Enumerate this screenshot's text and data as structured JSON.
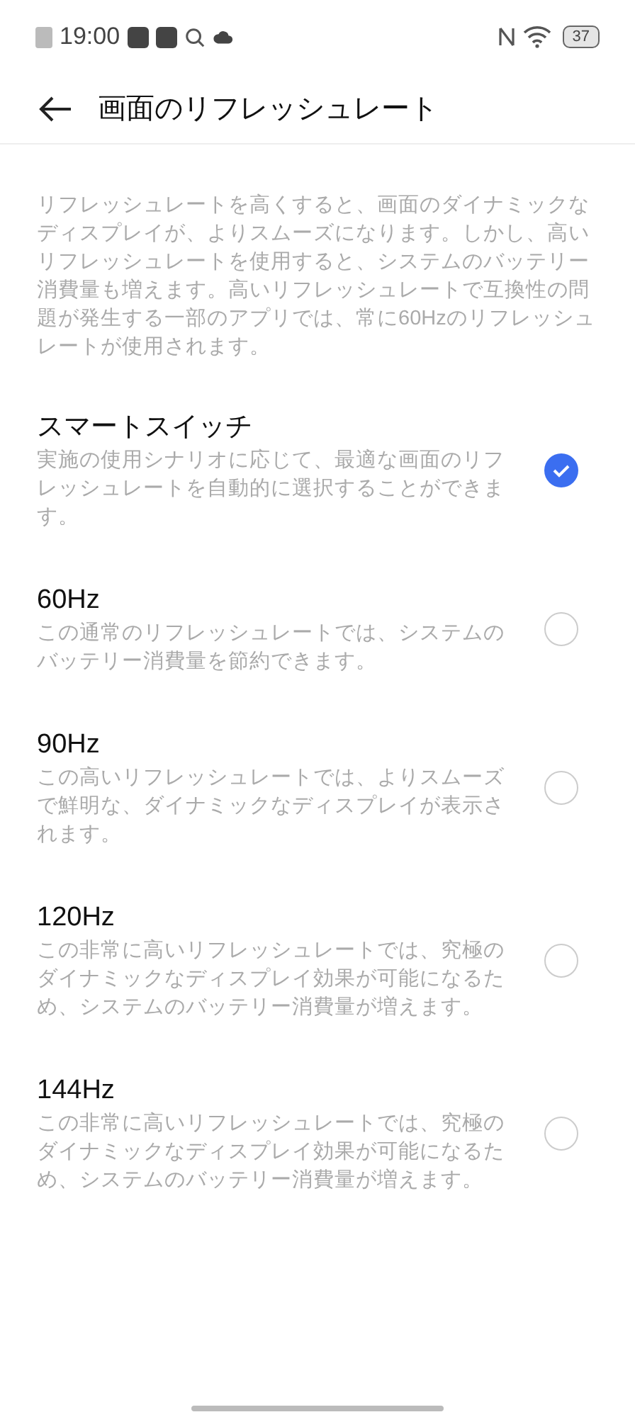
{
  "status_bar": {
    "time": "19:00",
    "battery": "37"
  },
  "header": {
    "title": "画面のリフレッシュレート"
  },
  "intro": "リフレッシュレートを高くすると、画面のダイナミックなディスプレイが、よりスムーズになります。しかし、高いリフレッシュレートを使用すると、システムのバッテリー消費量も増えます。高いリフレッシュレートで互換性の問題が発生する一部のアプリでは、常に60Hzのリフレッシュレートが使用されます。",
  "options": [
    {
      "title": "スマートスイッチ",
      "description": "実施の使用シナリオに応じて、最適な画面のリフレッシュレートを自動的に選択することができます。",
      "selected": true
    },
    {
      "title": "60Hz",
      "description": "この通常のリフレッシュレートでは、システムのバッテリー消費量を節約できます。",
      "selected": false
    },
    {
      "title": "90Hz",
      "description": "この高いリフレッシュレートでは、よりスムーズで鮮明な、ダイナミックなディスプレイが表示されます。",
      "selected": false
    },
    {
      "title": "120Hz",
      "description": "この非常に高いリフレッシュレートでは、究極のダイナミックなディスプレイ効果が可能になるため、システムのバッテリー消費量が増えます。",
      "selected": false
    },
    {
      "title": "144Hz",
      "description": "この非常に高いリフレッシュレートでは、究極のダイナミックなディスプレイ効果が可能になるため、システムのバッテリー消費量が増えます。",
      "selected": false
    }
  ]
}
